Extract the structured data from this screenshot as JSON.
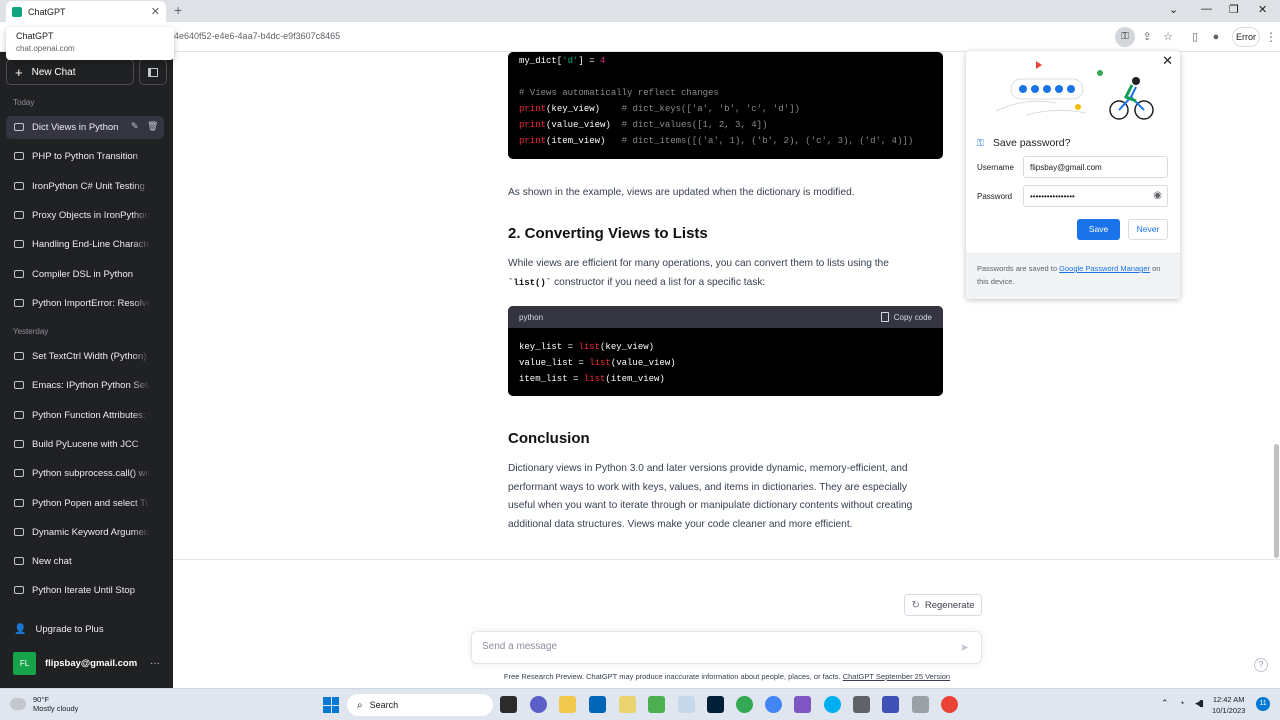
{
  "browser": {
    "tab_title": "ChatGPT",
    "url_fragment": "4e640f52-e4e6-4aa7-b4dc-e9f3607c8465",
    "error_label": "Error",
    "tooltip": {
      "title": "ChatGPT",
      "domain": "chat.openai.com"
    }
  },
  "sidebar": {
    "new_chat_label": "New Chat",
    "today_label": "Today",
    "yesterday_label": "Yesterday",
    "today_items": [
      {
        "label": "Dict Views in Python"
      },
      {
        "label": "PHP to Python Transition"
      },
      {
        "label": "IronPython C# Unit Testing"
      },
      {
        "label": "Proxy Objects in IronPython"
      },
      {
        "label": "Handling End-Line Characters"
      },
      {
        "label": "Compiler DSL in Python"
      },
      {
        "label": "Python ImportError: Resolve"
      }
    ],
    "yesterday_items": [
      {
        "label": "Set TextCtrl Width (Python)"
      },
      {
        "label": "Emacs: IPython Python Setup"
      },
      {
        "label": "Python Function Attributes: U"
      },
      {
        "label": "Build PyLucene with JCC"
      },
      {
        "label": "Python subprocess.call() with"
      },
      {
        "label": "Python Popen and select Tut"
      },
      {
        "label": "Dynamic Keyword Arguments"
      },
      {
        "label": "New chat"
      },
      {
        "label": "Python Iterate Until Stop"
      }
    ],
    "upgrade_label": "Upgrade to Plus",
    "account": {
      "initials": "FL",
      "email": "flipsbay@gmail.com"
    }
  },
  "content": {
    "code1": {
      "lines": [
        {
          "a": "my_dict[",
          "b": "'d'",
          "c": "] = ",
          "d": "4"
        },
        {
          "comment": "# Views automatically reflect changes"
        },
        {
          "fn": "print",
          "args": "(key_view)",
          "comment": "# dict_keys(['a', 'b', 'c', 'd'])"
        },
        {
          "fn": "print",
          "args": "(value_view)",
          "comment": "# dict_values([1, 2, 3, 4])"
        },
        {
          "fn": "print",
          "args": "(item_view)",
          "comment": "# dict_items([('a', 1), ('b', 2), ('c', 3), ('d', 4)])"
        }
      ]
    },
    "para1": "As shown in the example, views are updated when the dictionary is modified.",
    "heading2": "2. Converting Views to Lists",
    "para2_a": "While views are efficient for many operations, you can convert them to lists using the",
    "para2_code": "`list()`",
    "para2_b": "constructor if you need a list for a specific task:",
    "code2": {
      "lang": "python",
      "copy_label": "Copy code",
      "lines": [
        {
          "var": "key_list = ",
          "fn": "list",
          "args": "(key_view)"
        },
        {
          "var": "value_list = ",
          "fn": "list",
          "args": "(value_view)"
        },
        {
          "var": "item_list = ",
          "fn": "list",
          "args": "(item_view)"
        }
      ]
    },
    "heading3": "Conclusion",
    "conclusion": [
      "Dictionary views in Python 3.0 and later versions provide dynamic, memory-efficient, and",
      "performant ways to work with keys, values, and items in dictionaries. They are especially",
      "useful when you want to iterate through or manipulate dictionary contents without creating",
      "additional data structures. Views make your code cleaner and more efficient."
    ],
    "regenerate_label": "Regenerate",
    "message_placeholder": "Send a message",
    "disclaimer_text": "Free Research Preview. ChatGPT may produce inaccurate information about people, places, or facts.",
    "disclaimer_link": "ChatGPT September 25 Version"
  },
  "password_popup": {
    "title": "Save password?",
    "username_label": "Username",
    "username_value": "flipsbay@gmail.com",
    "password_label": "Password",
    "password_value": "••••••••••••••••",
    "save_label": "Save",
    "never_label": "Never",
    "footer_prefix": "Passwords are saved to",
    "footer_link": "Google Password Manager",
    "footer_suffix": "on this device."
  },
  "taskbar": {
    "weather_temp": "90°F",
    "weather_desc": "Mostly cloudy",
    "search_label": "Search",
    "time": "12:42 AM",
    "date": "10/1/2023",
    "notifications": "11"
  },
  "colors": {
    "sidebar_bg": "#202123",
    "accent_green": "#10a37f",
    "google_blue": "#1a73e8"
  }
}
